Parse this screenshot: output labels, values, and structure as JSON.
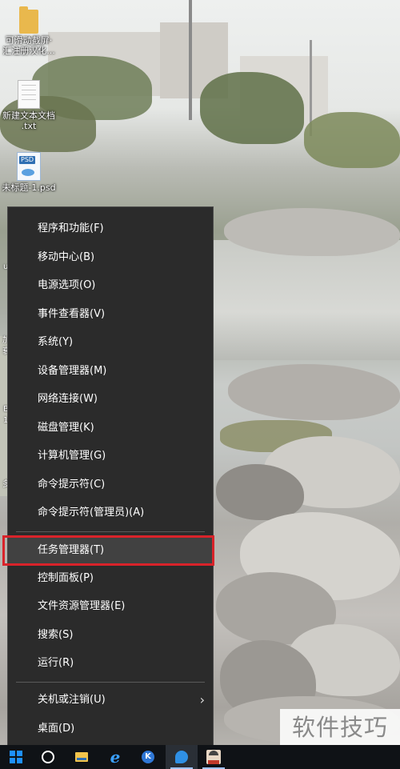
{
  "desktop": {
    "icons": [
      {
        "label_line1": "可滑动截屏·",
        "label_line2": "汇注册汉化..."
      },
      {
        "label_line1": "新建文本文档",
        "label_line2": ".txt"
      },
      {
        "label_line1": "未标题-1.psd",
        "label_line2": "",
        "badge": "PSD"
      }
    ],
    "edge_fragments": [
      "u",
      "加",
      "衰",
      "B",
      "1",
      "多"
    ]
  },
  "context_menu": {
    "items": [
      {
        "label": "程序和功能(F)"
      },
      {
        "label": "移动中心(B)"
      },
      {
        "label": "电源选项(O)"
      },
      {
        "label": "事件查看器(V)"
      },
      {
        "label": "系统(Y)"
      },
      {
        "label": "设备管理器(M)"
      },
      {
        "label": "网络连接(W)"
      },
      {
        "label": "磁盘管理(K)"
      },
      {
        "label": "计算机管理(G)"
      },
      {
        "label": "命令提示符(C)"
      },
      {
        "label": "命令提示符(管理员)(A)"
      },
      {
        "label": "任务管理器(T)"
      },
      {
        "label": "控制面板(P)"
      },
      {
        "label": "文件资源管理器(E)"
      },
      {
        "label": "搜索(S)"
      },
      {
        "label": "运行(R)"
      },
      {
        "label": "关机或注销(U)",
        "submenu_icon": "chevron-right-icon"
      },
      {
        "label": "桌面(D)"
      }
    ],
    "highlighted_item": "任务管理器(T)",
    "highlight_color": "#d9232a"
  },
  "taskbar": {
    "icons": [
      "windows-start-icon",
      "cortana-icon",
      "file-explorer-icon",
      "internet-explorer-icon",
      "k-app-icon",
      "app-icon",
      "user-avatar-icon"
    ],
    "ie_glyph": "e",
    "k_glyph": "K"
  },
  "watermark": {
    "text": "软件技巧"
  }
}
